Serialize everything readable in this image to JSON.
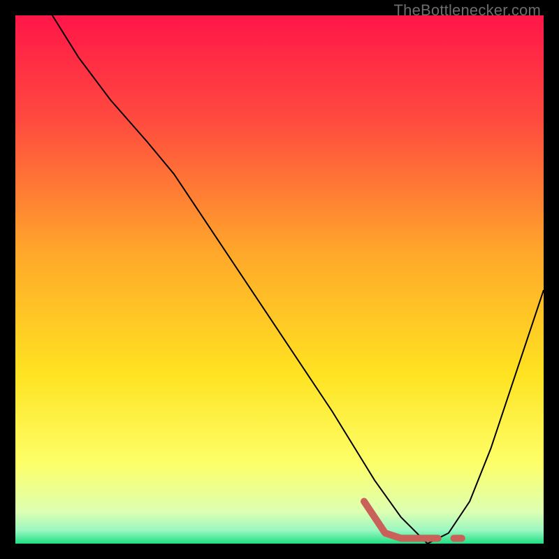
{
  "watermark": "TheBottlenecker.com",
  "chart_data": {
    "type": "line",
    "title": "",
    "xlabel": "",
    "ylabel": "",
    "xlim": [
      0,
      100
    ],
    "ylim": [
      0,
      100
    ],
    "grid": false,
    "series": [
      {
        "name": "curve",
        "color": "#000000",
        "stroke_width": 2,
        "x": [
          7,
          12,
          18,
          25,
          30,
          40,
          50,
          60,
          68,
          73,
          78,
          82,
          86,
          90,
          94,
          100
        ],
        "y": [
          100,
          92,
          84,
          76,
          70,
          55,
          40,
          25,
          12,
          5,
          0,
          2,
          8,
          18,
          30,
          48
        ]
      },
      {
        "name": "bump",
        "color": "#c9615a",
        "stroke_width": 10,
        "linecap": "round",
        "x": [
          66,
          70,
          73,
          77,
          80
        ],
        "y": [
          8,
          2,
          1,
          1,
          1
        ]
      },
      {
        "name": "dot",
        "color": "#c9615a",
        "stroke_width": 10,
        "linecap": "round",
        "x": [
          83,
          84.5
        ],
        "y": [
          1,
          1
        ]
      }
    ],
    "gradient_stops": [
      {
        "offset": 0,
        "color": "#ff1648"
      },
      {
        "offset": 0.2,
        "color": "#ff4b3f"
      },
      {
        "offset": 0.45,
        "color": "#ffa82a"
      },
      {
        "offset": 0.68,
        "color": "#ffe321"
      },
      {
        "offset": 0.85,
        "color": "#fdff6a"
      },
      {
        "offset": 0.94,
        "color": "#dcffb2"
      },
      {
        "offset": 0.975,
        "color": "#9af7c1"
      },
      {
        "offset": 1.0,
        "color": "#1fe083"
      }
    ]
  }
}
